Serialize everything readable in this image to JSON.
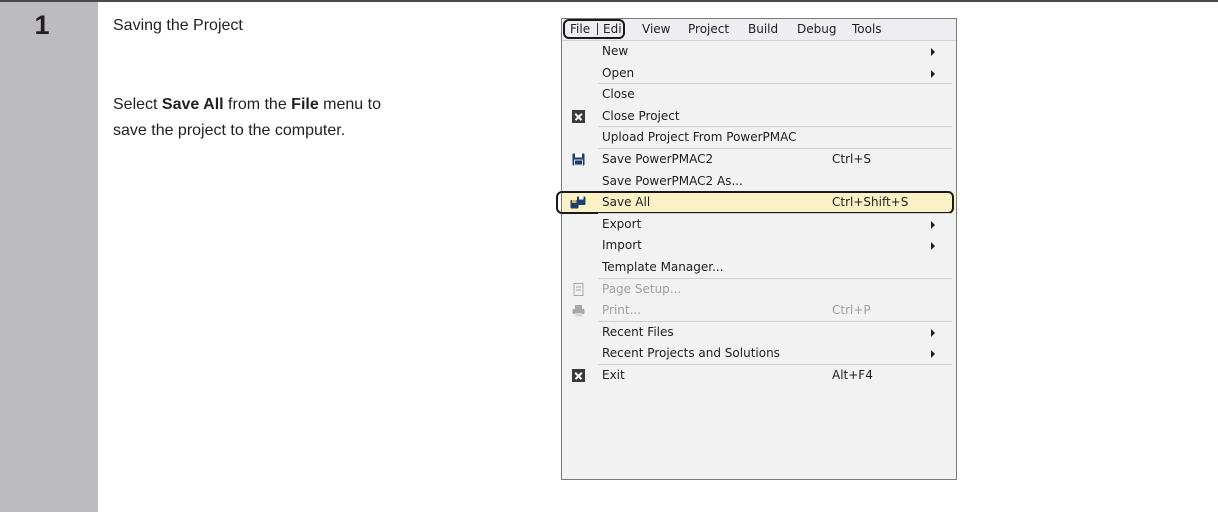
{
  "step": {
    "number": "1",
    "title": "Saving the Project",
    "desc_pre": "Select ",
    "desc_bold1": "Save All",
    "desc_mid": " from the ",
    "desc_bold2": "File",
    "desc_post": " menu to save the project to the computer."
  },
  "menubar": {
    "items": [
      "File",
      "Edit",
      "View",
      "Project",
      "Build",
      "Debug",
      "Tools"
    ]
  },
  "file_menu": {
    "items": [
      {
        "label": "New",
        "shortcut": "",
        "submenu": true,
        "icon": "",
        "disabled": false
      },
      {
        "label": "Open",
        "shortcut": "",
        "submenu": true,
        "icon": "",
        "disabled": false
      },
      {
        "label": "Close",
        "shortcut": "",
        "submenu": false,
        "icon": "",
        "disabled": false
      },
      {
        "label": "Close Project",
        "shortcut": "",
        "submenu": false,
        "icon": "close-project-icon",
        "disabled": false
      },
      {
        "label": "Upload Project From PowerPMAC",
        "shortcut": "",
        "submenu": false,
        "icon": "",
        "disabled": false
      },
      {
        "label": "Save PowerPMAC2",
        "shortcut": "Ctrl+S",
        "submenu": false,
        "icon": "floppy-disk-icon",
        "disabled": false
      },
      {
        "label": "Save PowerPMAC2 As...",
        "shortcut": "",
        "submenu": false,
        "icon": "",
        "disabled": false
      },
      {
        "label": "Save All",
        "shortcut": "Ctrl+Shift+S",
        "submenu": false,
        "icon": "save-all-icon",
        "disabled": false
      },
      {
        "label": "Export",
        "shortcut": "",
        "submenu": true,
        "icon": "",
        "disabled": false
      },
      {
        "label": "Import",
        "shortcut": "",
        "submenu": true,
        "icon": "",
        "disabled": false
      },
      {
        "label": "Template Manager...",
        "shortcut": "",
        "submenu": false,
        "icon": "",
        "disabled": false
      },
      {
        "label": "Page Setup...",
        "shortcut": "",
        "submenu": false,
        "icon": "page-setup-icon",
        "disabled": true
      },
      {
        "label": "Print...",
        "shortcut": "Ctrl+P",
        "submenu": false,
        "icon": "printer-icon",
        "disabled": true
      },
      {
        "label": "Recent Files",
        "shortcut": "",
        "submenu": true,
        "icon": "",
        "disabled": false
      },
      {
        "label": "Recent Projects and Solutions",
        "shortcut": "",
        "submenu": true,
        "icon": "",
        "disabled": false
      },
      {
        "label": "Exit",
        "shortcut": "Alt+F4",
        "submenu": false,
        "icon": "exit-icon",
        "disabled": false
      }
    ]
  },
  "colors": {
    "highlight": "#fbf1c7",
    "step_column": "#bcbcbe"
  }
}
